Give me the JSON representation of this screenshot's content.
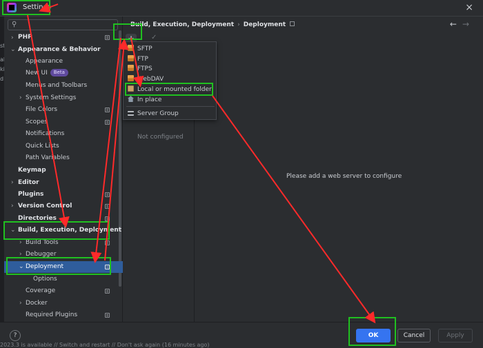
{
  "window": {
    "title": "Settings"
  },
  "left_edge": [
    "st",
    "ah",
    "ki",
    "d"
  ],
  "search": {
    "placeholder": ""
  },
  "tree": [
    {
      "label": "PHP",
      "bold": true
    },
    {
      "label": "Appearance & Behavior",
      "bold": true
    },
    {
      "label": "Appearance"
    },
    {
      "label": "New UI",
      "badge": "Beta"
    },
    {
      "label": "Menus and Toolbars"
    },
    {
      "label": "System Settings"
    },
    {
      "label": "File Colors"
    },
    {
      "label": "Scopes"
    },
    {
      "label": "Notifications"
    },
    {
      "label": "Quick Lists"
    },
    {
      "label": "Path Variables"
    },
    {
      "label": "Keymap",
      "bold": true
    },
    {
      "label": "Editor",
      "bold": true
    },
    {
      "label": "Plugins",
      "bold": true
    },
    {
      "label": "Version Control",
      "bold": true
    },
    {
      "label": "Directories",
      "bold": true
    },
    {
      "label": "Build, Execution, Deployment",
      "bold": true
    },
    {
      "label": "Build Tools"
    },
    {
      "label": "Debugger"
    },
    {
      "label": "Deployment"
    },
    {
      "label": "Options"
    },
    {
      "label": "Coverage"
    },
    {
      "label": "Docker"
    },
    {
      "label": "Required Plugins"
    }
  ],
  "breadcrumb": [
    "Build, Execution, Deployment",
    "Deployment"
  ],
  "breadcrumb_sep": "›",
  "nav": {
    "back": "←",
    "forward": "→"
  },
  "toolbar": {
    "add": "+",
    "check": "✓"
  },
  "popup": {
    "items": [
      "SFTP",
      "FTP",
      "FTPS",
      "WebDAV",
      "Local or mounted folder",
      "In place",
      "Server Group"
    ]
  },
  "list_pane": {
    "empty": "Not configured"
  },
  "detail": {
    "empty": "Please add a web server to configure"
  },
  "footer": {
    "help": "?",
    "ok": "OK",
    "cancel": "Cancel",
    "apply": "Apply",
    "status": "2023.3 is available // Switch and restart // Don't ask again (16 minutes ago)"
  },
  "icons": {
    "close": "×",
    "search": "⚲",
    "chevron_right": "›",
    "chevron_down": "⌄"
  },
  "colors": {
    "accent": "#3574f0",
    "highlight": "#20c020",
    "arrow": "#ff2a2a",
    "selection": "#2f5d9c"
  }
}
